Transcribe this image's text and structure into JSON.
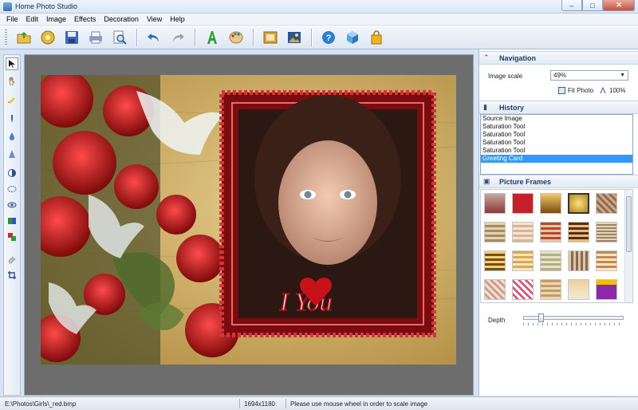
{
  "window": {
    "title": "Home Photo Studio"
  },
  "menu": [
    "File",
    "Edit",
    "Image",
    "Effects",
    "Decoration",
    "View",
    "Help"
  ],
  "toolbar": [
    "open-icon",
    "photo-disc-icon",
    "save-icon",
    "print-icon",
    "print-preview-icon",
    "undo-icon",
    "redo-icon",
    "text-icon",
    "palette-icon",
    "picture-frame-icon",
    "photo-icon",
    "help-icon",
    "cube-icon",
    "shopping-bag-icon"
  ],
  "tools": [
    "pointer-tool-icon",
    "hand-tool-icon",
    "brush-tool-icon",
    "pen-tool-icon",
    "drop-tool-icon",
    "cone-tool-icon",
    "contrast-tool-icon",
    "selection-tool-icon",
    "eye-tool-icon",
    "levels-tool-icon",
    "colors-tool-icon",
    "eraser-tool-icon",
    "crop-tool-icon"
  ],
  "navigation": {
    "title": "Navigation",
    "scale_label": "Image scale",
    "scale_value": "49%",
    "fit_label": "Fit Photo",
    "full_label": "100%"
  },
  "history": {
    "title": "History",
    "items": [
      "Source Image",
      "Saturation Tool",
      "Saturation Tool",
      "Saturation Tool",
      "Saturation Tool",
      "Greeting Card"
    ],
    "selected_index": 5
  },
  "frames": {
    "title": "Picture Frames",
    "depth_label": "Depth",
    "depth_value": 0.16
  },
  "photo": {
    "caption": "I You"
  },
  "status": {
    "path": "E:\\Photos\\Girls\\_red.bmp",
    "size": "1694x1180",
    "hint": "Please use mouse wheel in order to scale image"
  },
  "colors": {
    "accent": "#3399ff",
    "frame_red": "#b31c22",
    "canvas": "#6d6d6d"
  }
}
